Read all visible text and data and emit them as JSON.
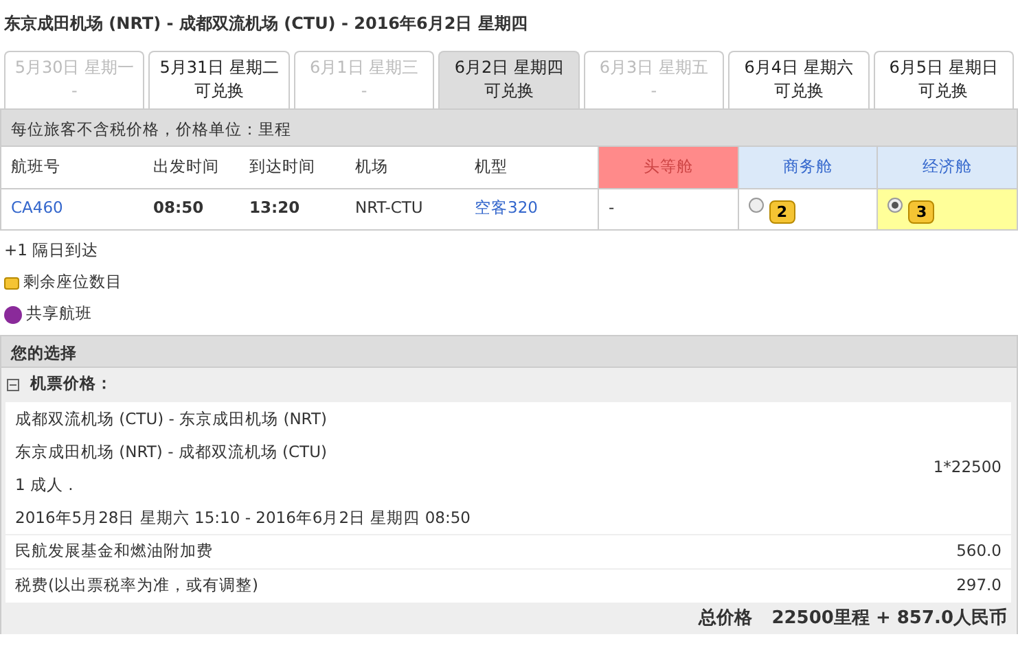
{
  "title": "东京成田机场 (NRT) - 成都双流机场 (CTU) - 2016年6月2日 星期四",
  "date_tabs": [
    {
      "date": "5月30日 星期一",
      "status": "-",
      "selected": false,
      "disabled": true
    },
    {
      "date": "5月31日 星期二",
      "status": "可兑换",
      "selected": false,
      "disabled": false
    },
    {
      "date": "6月1日 星期三",
      "status": "-",
      "selected": false,
      "disabled": true
    },
    {
      "date": "6月2日 星期四",
      "status": "可兑换",
      "selected": true,
      "disabled": false
    },
    {
      "date": "6月3日 星期五",
      "status": "-",
      "selected": false,
      "disabled": true
    },
    {
      "date": "6月4日 星期六",
      "status": "可兑换",
      "selected": false,
      "disabled": false
    },
    {
      "date": "6月5日 星期日",
      "status": "可兑换",
      "selected": false,
      "disabled": false
    }
  ],
  "price_note": "每位旅客不含税价格，价格单位：里程",
  "flight_table": {
    "columns": [
      "航班号",
      "出发时间",
      "到达时间",
      "机场",
      "机型"
    ],
    "cabins": [
      {
        "label": "头等舱",
        "color": "#ff8a8a"
      },
      {
        "label": "商务舱",
        "color": "#dbe9f9"
      },
      {
        "label": "经济舱",
        "color": "#dbe9f9"
      }
    ],
    "rows": [
      {
        "flight": "CA460",
        "depart": "08:50",
        "arrive": "13:20",
        "airport": "NRT-CTU",
        "aircraft": "空客320",
        "cabins": [
          {
            "kind": "none",
            "text": "-"
          },
          {
            "kind": "seats",
            "seats": "2",
            "selected": false
          },
          {
            "kind": "seats",
            "seats": "3",
            "selected": true
          }
        ]
      }
    ]
  },
  "legend": [
    {
      "kind": "text",
      "text": "+1 隔日到达"
    },
    {
      "kind": "seat",
      "text": "剩余座位数目"
    },
    {
      "kind": "share",
      "text": "共享航班"
    }
  ],
  "selection": {
    "title": "您的选择",
    "section": "机票价格：",
    "expanded": true,
    "segments": [
      "成都双流机场 (CTU) - 东京成田机场 (NRT)",
      "东京成田机场 (NRT) - 成都双流机场 (CTU)",
      "1 成人 .",
      "2016年5月28日 星期六 15:10 - 2016年6月2日 星期四 08:50"
    ],
    "fare": "1*22500",
    "fees": [
      {
        "label": "民航发展基金和燃油附加费",
        "amount": "560.0"
      },
      {
        "label": "税费(以出票税率为准，或有调整)",
        "amount": "297.0"
      }
    ],
    "total_label": "总价格",
    "total": "22500里程 + 857.0人民币"
  }
}
